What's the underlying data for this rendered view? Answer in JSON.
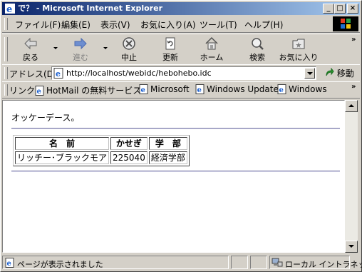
{
  "window": {
    "title": "で？ - Microsoft Internet Explorer"
  },
  "menu": [
    "ファイル(F)",
    "編集(E)",
    "表示(V)",
    "お気に入り(A)",
    "ツール(T)",
    "ヘルプ(H)"
  ],
  "toolbar": {
    "back": "戻る",
    "forward": "進む",
    "stop": "中止",
    "refresh": "更新",
    "home": "ホーム",
    "search": "検索",
    "favorites": "お気に入り"
  },
  "address": {
    "label": "アドレス(D)",
    "url": "http://localhost/webidc/hebohebo.idc",
    "go": "移動"
  },
  "links": {
    "label": "リンク",
    "items": [
      "HotMail の無料サービス",
      "Microsoft",
      "Windows Update",
      "Windows"
    ]
  },
  "page": {
    "message": "オッケーデース。",
    "table": {
      "headers": [
        "名　前",
        "かせぎ",
        "学　部"
      ],
      "rows": [
        [
          "リッチー･ブラックモア",
          "225040",
          "経済学部"
        ]
      ]
    }
  },
  "status": {
    "text": "ページが表示されました",
    "zone": "ローカル イントラネット"
  },
  "colors": {
    "titlebar_start": "#0a246a",
    "titlebar_end": "#a6caf0",
    "chrome": "#d4d0c8"
  }
}
